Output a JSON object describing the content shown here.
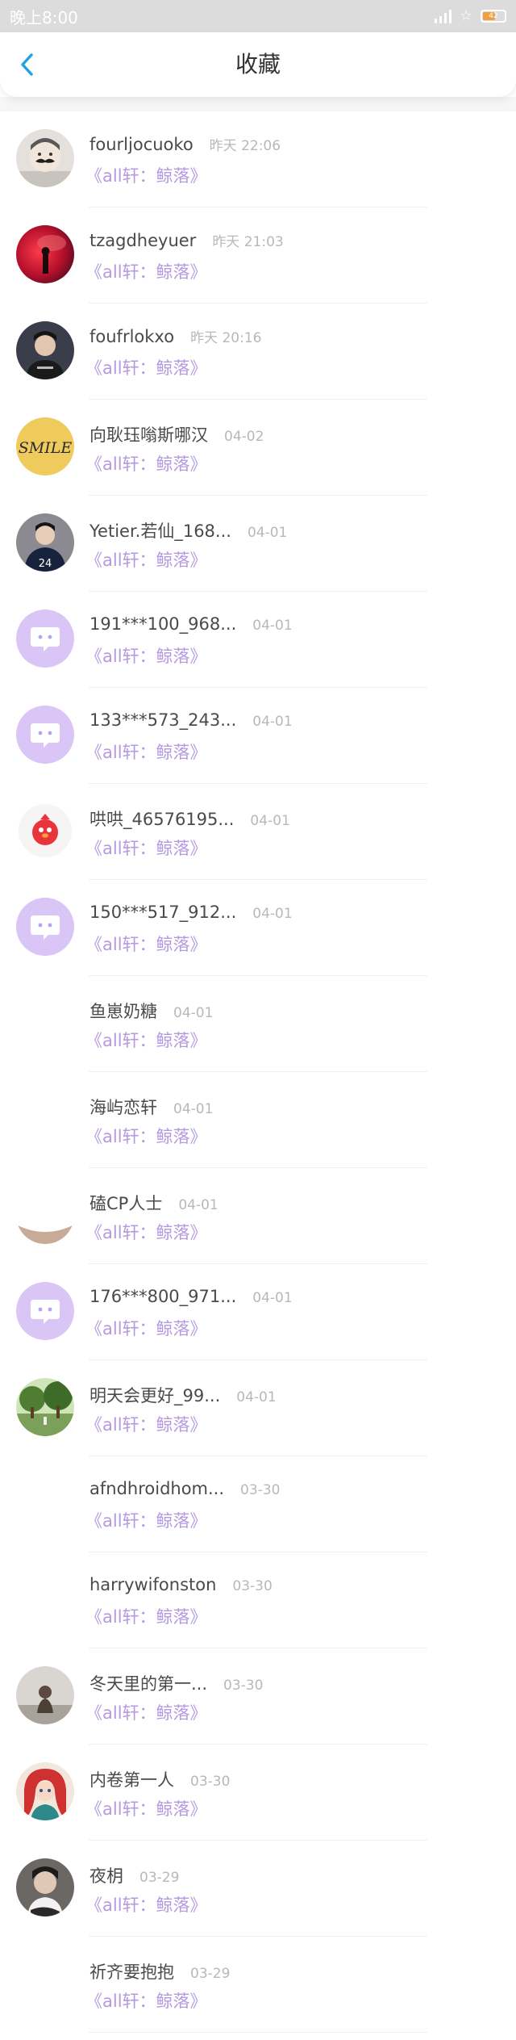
{
  "status_bar": {
    "time": "晚上8:00",
    "battery_level": "42",
    "icons": [
      "signal-icon",
      "star-icon",
      "battery-icon"
    ]
  },
  "header": {
    "title": "收藏",
    "back_icon": "chevron-left-icon"
  },
  "colors": {
    "accent": "#1fa3e0",
    "work_title": "#b59ae0",
    "status_bar": "#dcdcdc",
    "default_avatar_bg": "#d9c6f7"
  },
  "favorites": [
    {
      "username": "fourljocuoko",
      "time": "昨天 22:06",
      "work": "《all轩：鲸落》",
      "avatar": "mustache-photo"
    },
    {
      "username": "tzagdheyuer",
      "time": "昨天 21:03",
      "work": "《all轩：鲸落》",
      "avatar": "red-smoke-photo"
    },
    {
      "username": "foufrlokxo",
      "time": "昨天 20:16",
      "work": "《all轩：鲸落》",
      "avatar": "boy-photo"
    },
    {
      "username": "向耿珏嗡斯哪汉",
      "time": "04-02",
      "work": "《all轩：鲸落》",
      "avatar": "smile-text"
    },
    {
      "username": "Yetier.若仙_168...",
      "time": "04-01",
      "work": "《all轩：鲸落》",
      "avatar": "jersey-photo"
    },
    {
      "username": "191***100_968...",
      "time": "04-01",
      "work": "《all轩：鲸落》",
      "avatar": "default-chat-icon"
    },
    {
      "username": "133***573_243...",
      "time": "04-01",
      "work": "《all轩：鲸落》",
      "avatar": "default-chat-icon"
    },
    {
      "username": "哄哄_46576195...",
      "time": "04-01",
      "work": "《all轩：鲸落》",
      "avatar": "red-bird-icon"
    },
    {
      "username": "150***517_912...",
      "time": "04-01",
      "work": "《all轩：鲸落》",
      "avatar": "default-chat-icon"
    },
    {
      "username": "鱼崽奶糖",
      "time": "04-01",
      "work": "《all轩：鲸落》",
      "avatar": "none"
    },
    {
      "username": "海屿恋轩",
      "time": "04-01",
      "work": "《all轩：鲸落》",
      "avatar": "none"
    },
    {
      "username": "磕CP人士",
      "time": "04-01",
      "work": "《all轩：鲸落》",
      "avatar": "partial"
    },
    {
      "username": "176***800_971...",
      "time": "04-01",
      "work": "《all轩：鲸落》",
      "avatar": "default-chat-icon"
    },
    {
      "username": "明天会更好_99...",
      "time": "04-01",
      "work": "《all轩：鲸落》",
      "avatar": "green-park-photo"
    },
    {
      "username": "afndhroidhom...",
      "time": "03-30",
      "work": "《all轩：鲸落》",
      "avatar": "none"
    },
    {
      "username": "harrywifonston",
      "time": "03-30",
      "work": "《all轩：鲸落》",
      "avatar": "none"
    },
    {
      "username": "冬天里的第一...",
      "time": "03-30",
      "work": "《all轩：鲸落》",
      "avatar": "figure-photo"
    },
    {
      "username": "内卷第一人",
      "time": "03-30",
      "work": "《all轩：鲸落》",
      "avatar": "princess-photo"
    },
    {
      "username": "夜枂",
      "time": "03-29",
      "work": "《all轩：鲸落》",
      "avatar": "portrait-photo"
    },
    {
      "username": "祈齐要抱抱",
      "time": "03-29",
      "work": "《all轩：鲸落》",
      "avatar": "none"
    }
  ]
}
